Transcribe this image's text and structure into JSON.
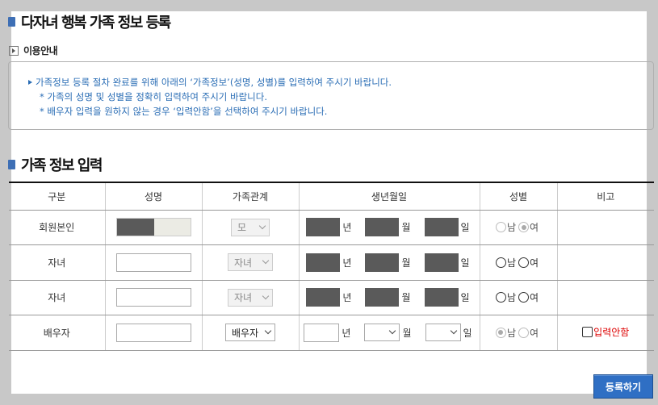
{
  "header": {
    "title": "다자녀 행복 가족 정보 등록"
  },
  "guide": {
    "title": "이용안내",
    "lines": [
      "가족정보 등록 절차 완료를 위해 아래의 ‘가족정보’(성명, 성별)를 입력하여 주시기 바랍니다.",
      "* 가족의 성명 및 성별을 정확히 입력하여 주시기 바랍니다.",
      "* 배우자 입력을 원하지 않는 경우 ‘입력안함’을 선택하여 주시기 바랍니다."
    ]
  },
  "form": {
    "title": "가족 정보 입력",
    "columns": [
      "구분",
      "성명",
      "가족관계",
      "생년월일",
      "성별",
      "비고"
    ],
    "date_labels": {
      "year": "년",
      "month": "월",
      "day": "일"
    },
    "gender_labels": {
      "male": "남",
      "female": "여"
    },
    "rows": [
      {
        "category": "회원본인",
        "relation": "모",
        "female_selected": true
      },
      {
        "category": "자녀",
        "relation": "자녀"
      },
      {
        "category": "자녀",
        "relation": "자녀"
      },
      {
        "category": "배우자",
        "relation": "배우자",
        "male_selected": true,
        "note": "입력안함"
      }
    ]
  },
  "actions": {
    "submit_label": "등록하기"
  },
  "colors": {
    "accent": "#2f6fc4",
    "info_text": "#2a6db5",
    "warn_text": "#dd0000",
    "mask": "#5a5a5a"
  }
}
